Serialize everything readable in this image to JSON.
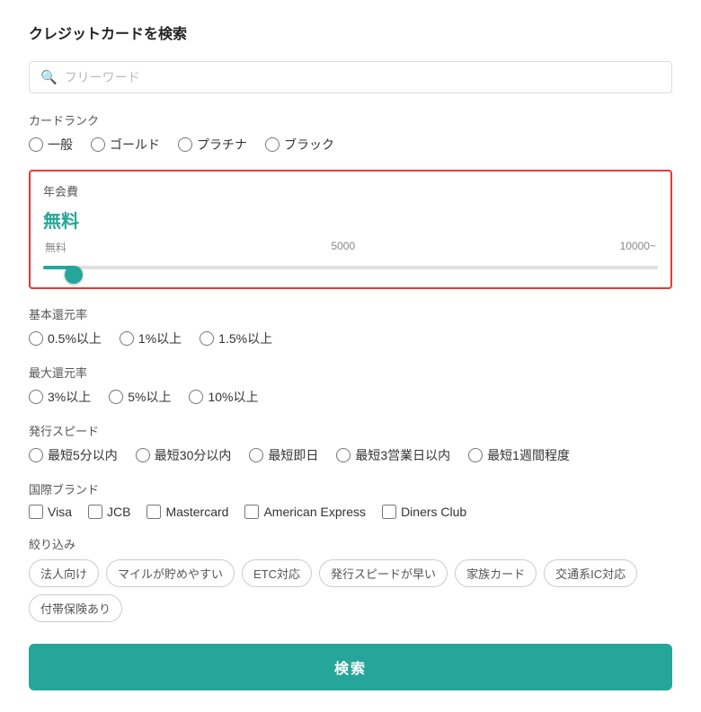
{
  "page": {
    "title": "クレジットカードを検索"
  },
  "search": {
    "placeholder": "フリーワード"
  },
  "card_rank": {
    "label": "カードランク",
    "options": [
      "一般",
      "ゴールド",
      "プラチナ",
      "ブラック"
    ]
  },
  "annual_fee": {
    "label": "年会費",
    "value": "無料",
    "range_labels": [
      "無料",
      "5000",
      "10000~"
    ]
  },
  "basic_return": {
    "label": "基本還元率",
    "options": [
      "0.5%以上",
      "1%以上",
      "1.5%以上"
    ]
  },
  "max_return": {
    "label": "最大還元率",
    "options": [
      "3%以上",
      "5%以上",
      "10%以上"
    ]
  },
  "issue_speed": {
    "label": "発行スピード",
    "options": [
      "最短5分以内",
      "最短30分以内",
      "最短即日",
      "最短3営業日以内",
      "最短1週間程度"
    ]
  },
  "brand": {
    "label": "国際ブランド",
    "options": [
      "Visa",
      "JCB",
      "Mastercard",
      "American Express",
      "Diners Club"
    ]
  },
  "filters": {
    "label": "絞り込み",
    "tags": [
      "法人向け",
      "マイルが貯めやすい",
      "ETC対応",
      "発行スピードが早い",
      "家族カード",
      "交通系IC対応",
      "付帯保険あり"
    ]
  },
  "search_button": {
    "label": "検索"
  }
}
